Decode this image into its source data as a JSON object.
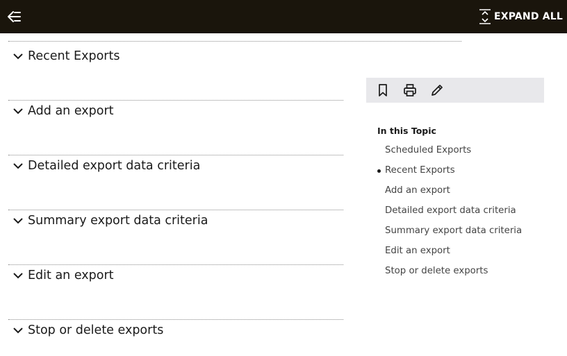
{
  "header": {
    "menu_icon": "collapse-menu-icon",
    "expand_all_label": "EXPAND ALL",
    "expand_icon": "expand-all-icon",
    "background": "#1a150c"
  },
  "sections": [
    {
      "title": "Recent Exports"
    },
    {
      "title": "Add an export"
    },
    {
      "title": "Detailed export data criteria"
    },
    {
      "title": "Summary export data criteria"
    },
    {
      "title": "Edit an export"
    },
    {
      "title": "Stop or delete exports"
    }
  ],
  "toolbar": {
    "buttons": [
      "bookmark-icon",
      "print-icon",
      "pencil-icon"
    ],
    "background": "#e8e8eb"
  },
  "toc": {
    "heading": "In this Topic",
    "items": [
      {
        "label": "Scheduled Exports",
        "active": false
      },
      {
        "label": "Recent Exports",
        "active": true
      },
      {
        "label": "Add an export",
        "active": false
      },
      {
        "label": "Detailed export data criteria",
        "active": false
      },
      {
        "label": "Summary export data criteria",
        "active": false
      },
      {
        "label": "Edit an export",
        "active": false
      },
      {
        "label": "Stop or delete exports",
        "active": false
      }
    ]
  }
}
